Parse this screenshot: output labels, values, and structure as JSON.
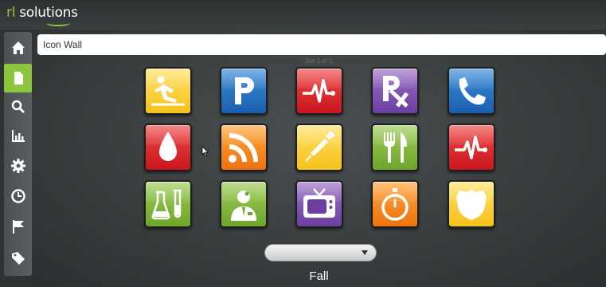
{
  "app": {
    "logo_prefix": "rl",
    "logo_suffix": " solutions"
  },
  "sidebar": {
    "items": [
      {
        "name": "home",
        "icon": "home-icon"
      },
      {
        "name": "document",
        "icon": "document-icon",
        "active": true
      },
      {
        "name": "search",
        "icon": "search-icon"
      },
      {
        "name": "reports",
        "icon": "bar-chart-icon"
      },
      {
        "name": "settings",
        "icon": "gear-icon"
      },
      {
        "name": "history",
        "icon": "clock-icon"
      },
      {
        "name": "flag",
        "icon": "flag-icon"
      },
      {
        "name": "tag",
        "icon": "tag-icon"
      }
    ]
  },
  "header": {
    "title": "Icon Wall"
  },
  "set_label": "Set 1 of 1",
  "icon_wall": [
    {
      "icon": "fall-person-icon",
      "color": "yellow"
    },
    {
      "icon": "parking-icon",
      "color": "blue"
    },
    {
      "icon": "heartbeat-icon",
      "color": "red"
    },
    {
      "icon": "prescription-rx-icon",
      "color": "purple"
    },
    {
      "icon": "phone-icon",
      "color": "blue"
    },
    {
      "icon": "blood-drop-icon",
      "color": "red"
    },
    {
      "icon": "rss-feed-icon",
      "color": "orange"
    },
    {
      "icon": "syringe-icon",
      "color": "yellow"
    },
    {
      "icon": "fork-knife-icon",
      "color": "green"
    },
    {
      "icon": "heartbeat-icon",
      "color": "red"
    },
    {
      "icon": "lab-flask-icon",
      "color": "green"
    },
    {
      "icon": "doctor-icon",
      "color": "green"
    },
    {
      "icon": "tv-icon",
      "color": "purple"
    },
    {
      "icon": "stopwatch-icon",
      "color": "orange"
    },
    {
      "icon": "security-badge-icon",
      "color": "yellow"
    }
  ],
  "category_select": {
    "value": ""
  },
  "caption": "Fall"
}
